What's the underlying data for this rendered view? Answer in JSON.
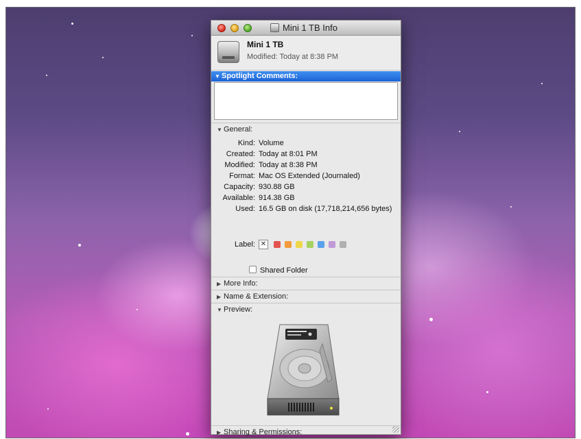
{
  "window": {
    "title": "Mini 1 TB Info"
  },
  "header": {
    "name": "Mini 1 TB",
    "modified": "Modified: Today at 8:38 PM"
  },
  "spotlight": {
    "label": "Spotlight Comments:",
    "value": ""
  },
  "general": {
    "label": "General:",
    "rows": [
      {
        "key": "Kind:",
        "value": "Volume"
      },
      {
        "key": "Created:",
        "value": "Today at 8:01 PM"
      },
      {
        "key": "Modified:",
        "value": "Today at 8:38 PM"
      },
      {
        "key": "Format:",
        "value": "Mac OS Extended (Journaled)"
      },
      {
        "key": "Capacity:",
        "value": "930.88 GB"
      },
      {
        "key": "Available:",
        "value": "914.38 GB"
      },
      {
        "key": "Used:",
        "value": "16.5 GB on disk (17,718,214,656 bytes)"
      }
    ],
    "label_key": "Label:",
    "label_colors": [
      "#e4534f",
      "#f29b3d",
      "#efd74c",
      "#a6d160",
      "#5aa1ea",
      "#c29ad8",
      "#b0b0b0"
    ],
    "shared_folder": "Shared Folder",
    "shared_folder_checked": false
  },
  "sections": {
    "more_info": "More Info:",
    "name_extension": "Name & Extension:",
    "preview": "Preview:",
    "sharing": "Sharing & Permissions:"
  },
  "icons": {
    "window_icon": "hard-drive-icon",
    "preview": "hard-drive-icon"
  }
}
